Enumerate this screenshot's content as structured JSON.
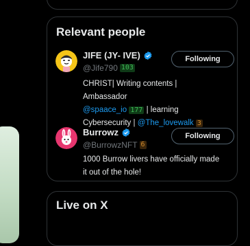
{
  "relevant": {
    "title": "Relevant people",
    "people": [
      {
        "name": "JIFE (JY- IVE)",
        "handle": "@Jife790",
        "handle_badge": "103",
        "follow_label": "Following",
        "bio": {
          "line1": "CHRIST| Writing contents | Ambassador",
          "mention1": "@spaace_io",
          "mention1_badge": "177",
          "after_mention1": "| learning",
          "line3": "Cybersecurity |",
          "mention2": "@The_lovewalk",
          "mention2_badge": "3"
        },
        "avatar_icon": "yellow-cartoon-avatar"
      },
      {
        "name": "Burrowz",
        "handle": "@BurrowzNFT",
        "handle_badge": "6",
        "follow_label": "Following",
        "bio": {
          "line1": "1000 Burrow livers have officially made",
          "line2": "it out of the hole!"
        },
        "avatar_icon": "pink-bunny-avatar"
      }
    ]
  },
  "live": {
    "title": "Live on X"
  },
  "colors": {
    "background": "#000000",
    "border": "#2f3336",
    "text": "#e7e9ea",
    "muted": "#71767b",
    "link": "#1d9bf0",
    "verified": "#1d9bf0"
  }
}
